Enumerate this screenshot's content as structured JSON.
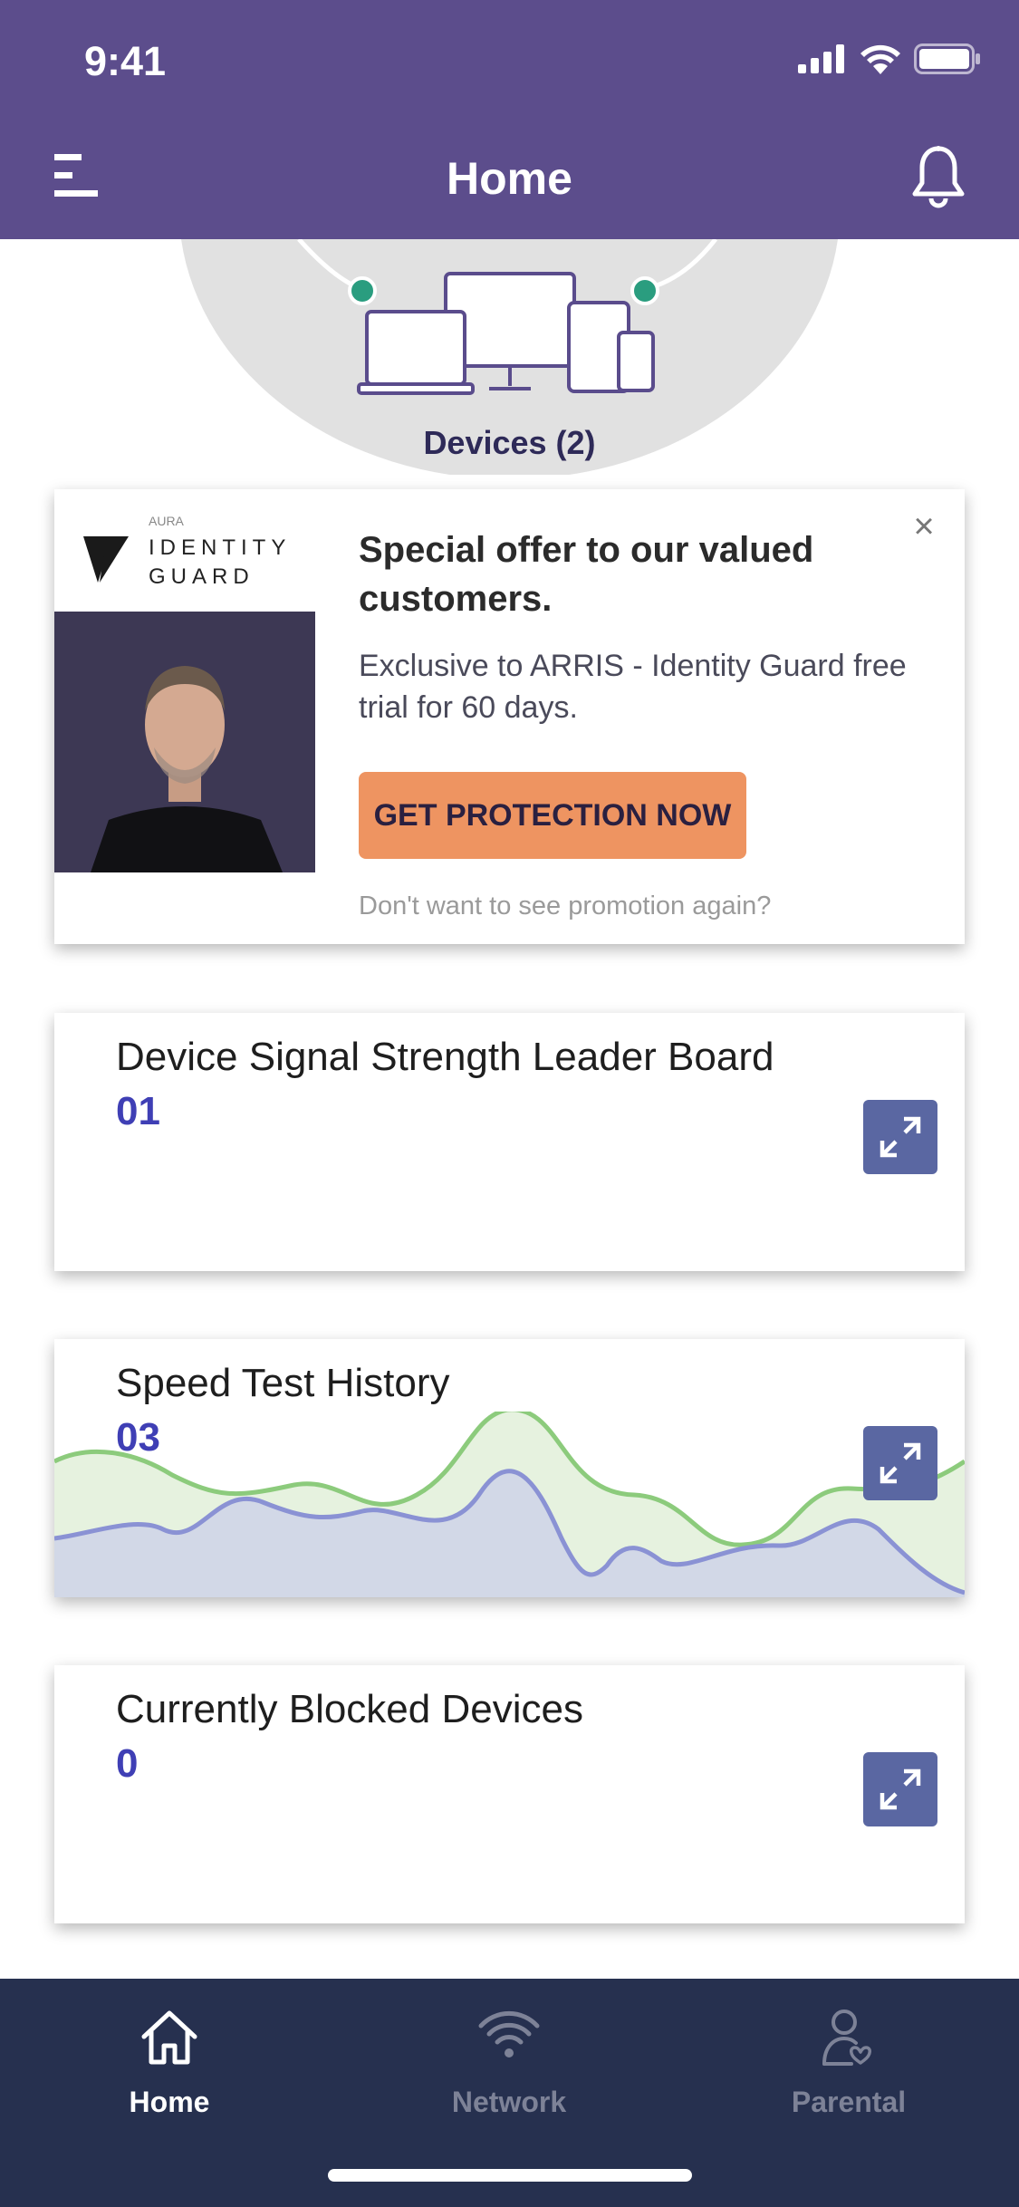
{
  "status_bar": {
    "time": "9:41"
  },
  "header": {
    "title": "Home"
  },
  "hero": {
    "devices_label": "Devices (2)"
  },
  "promo": {
    "brand_small": "AURA",
    "brand_line1": "IDENTITY",
    "brand_line2": "GUARD",
    "title": "Special offer to our valued customers.",
    "body": "Exclusive to ARRIS - Identity Guard free trial for 60 days.",
    "cta_label": "GET PROTECTION NOW",
    "opt_out": "Don't want to see promotion again?",
    "close_symbol": "×"
  },
  "widgets": [
    {
      "title": "Device Signal Strength Leader Board",
      "value": "01"
    },
    {
      "title": "Speed Test History",
      "value": "03"
    },
    {
      "title": "Currently Blocked Devices",
      "value": "0"
    }
  ],
  "tabs": [
    {
      "label": "Home",
      "icon": "home-icon",
      "active": true
    },
    {
      "label": "Network",
      "icon": "wifi-icon",
      "active": false
    },
    {
      "label": "Parental",
      "icon": "parental-icon",
      "active": false
    }
  ],
  "colors": {
    "header_bg": "#5c4d8c",
    "tabbar_bg": "#26304f",
    "accent_value": "#3f3fb5",
    "cta_bg": "#ee9461",
    "expand_btn": "#5a67a2",
    "node_green": "#2a9d7f"
  }
}
